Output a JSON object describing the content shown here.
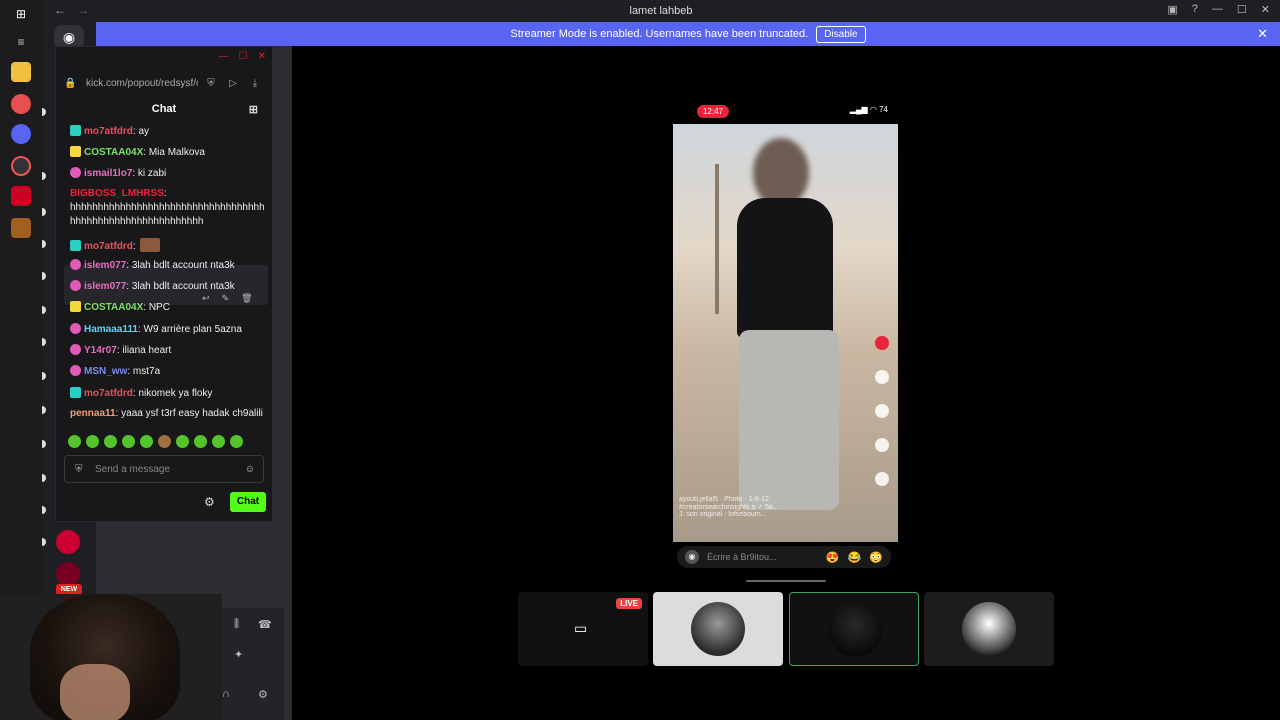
{
  "window": {
    "title": "lamet lahbeb",
    "nav_back": "←",
    "nav_fwd": "→",
    "minimize": "—",
    "maximize": "☐",
    "close": "✕"
  },
  "banner": {
    "text": "Streamer Mode is enabled. Usernames have been truncated.",
    "disable_label": "Disable",
    "close": "✕"
  },
  "popout": {
    "url": "kick.com/popout/redsysf/c",
    "chat_title": "Chat",
    "messages": [
      {
        "user": "mo7atfdrd",
        "text": ": ay",
        "badge": "teal",
        "color": "#e8505b"
      },
      {
        "user": "COSTAA04X",
        "text": ": Mia Malkova",
        "badge": "yellow",
        "color": "#7ee06a"
      },
      {
        "user": "ismail1lo7",
        "text": ": ki zabi",
        "badge": "pink",
        "color": "#e86fbf"
      },
      {
        "user": "BIGBOSS_LMHRSS",
        "text": ":",
        "badge": "",
        "color": "#e8243a"
      },
      {
        "user": "",
        "text": "hhhhhhhhhhhhhhhhhhhhhhhhhhhhhhhhhhh",
        "badge": "",
        "color": "#eee"
      },
      {
        "user": "",
        "text": "hhhhhhhhhhhhhhhhhhhhhhhh",
        "badge": "",
        "color": "#eee"
      },
      {
        "user": "mo7atfdrd",
        "text": ":",
        "badge": "teal",
        "color": "#e8505b"
      },
      {
        "user": "islem077",
        "text": ": 3lah bdlt account nta3k",
        "badge": "pink",
        "color": "#e86fbf"
      },
      {
        "user": "islem077",
        "text": ": 3lah bdlt account nta3k",
        "badge": "pink",
        "color": "#e86fbf"
      },
      {
        "user": "COSTAA04X",
        "text": ": NPC",
        "badge": "yellow",
        "color": "#7ee06a"
      },
      {
        "user": "Hamaaa111",
        "text": ": W9 arrière plan 5azna",
        "badge": "pink",
        "color": "#5bd4f0"
      },
      {
        "user": "Y14r07",
        "text": ": iliana heart",
        "badge": "pink",
        "color": "#e86fbf"
      },
      {
        "user": "MSN_ww",
        "text": ": mst7a",
        "badge": "pink",
        "color": "#7c8cf0"
      },
      {
        "user": "mo7atfdrd",
        "text": ": nikomek ya floky",
        "badge": "teal",
        "color": "#e8505b"
      },
      {
        "user": "pennaa11",
        "text": ": yaaa ysf t3rf easy hadak ch9alili",
        "badge": "",
        "color": "#f0a07a"
      }
    ],
    "input_placeholder": "Send a message",
    "chat_button": "Chat"
  },
  "phone": {
    "time": "12:47",
    "battery": "74",
    "caption_user": "ayoub.jellal5",
    "caption_tag": "Photo",
    "caption_date": "1-8-12",
    "caption_line2": "#creatorsearchinsights a ✓ 5a...",
    "caption_line3": "J: son original - lofseboum...",
    "comment_placeholder": "Écrire à Br9itou...",
    "emojis": [
      "😍",
      "😂",
      "😳"
    ]
  },
  "tiles": {
    "live_label": "LIVE"
  },
  "sidebar": {
    "new_label": "NEW"
  }
}
